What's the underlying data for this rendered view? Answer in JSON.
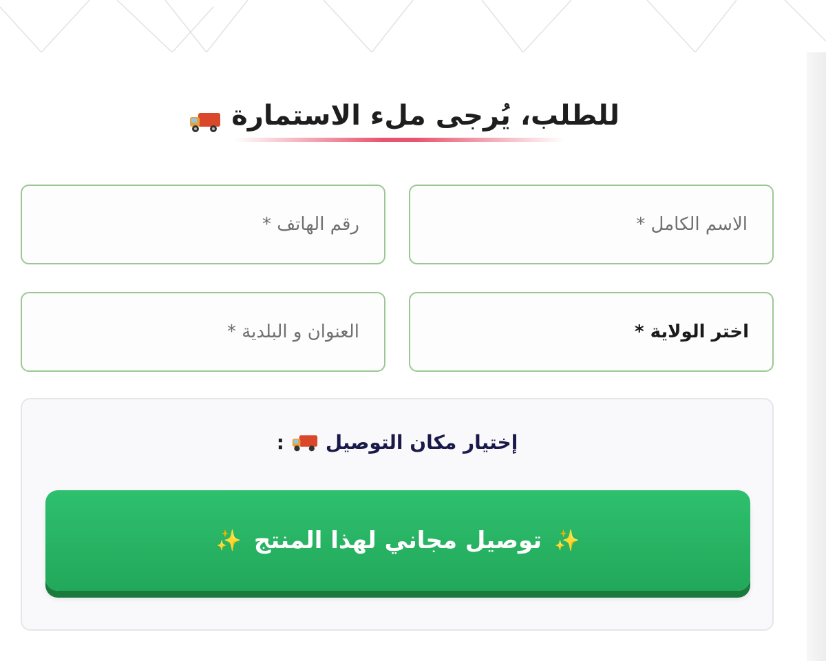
{
  "form": {
    "title": "للطلب، يُرجى ملء الاستمارة",
    "title_icon": "delivery-truck-icon",
    "fields": {
      "full_name_placeholder": "الاسم الكامل *",
      "phone_placeholder": "رقم الهاتف *",
      "state_select_label": "اختر الولاية *",
      "address_placeholder": "العنوان و البلدية *"
    }
  },
  "delivery": {
    "title": "إختيار مكان التوصيل",
    "title_icon": "delivery-truck-icon",
    "title_suffix": ":",
    "free_delivery_button": "توصيل مجاني لهذا المنتج",
    "button_icons": "sparkles-icon"
  },
  "colors": {
    "field_border": "#9cc794",
    "button_green": "#2ec06e",
    "title_underline": "#e8546c"
  }
}
